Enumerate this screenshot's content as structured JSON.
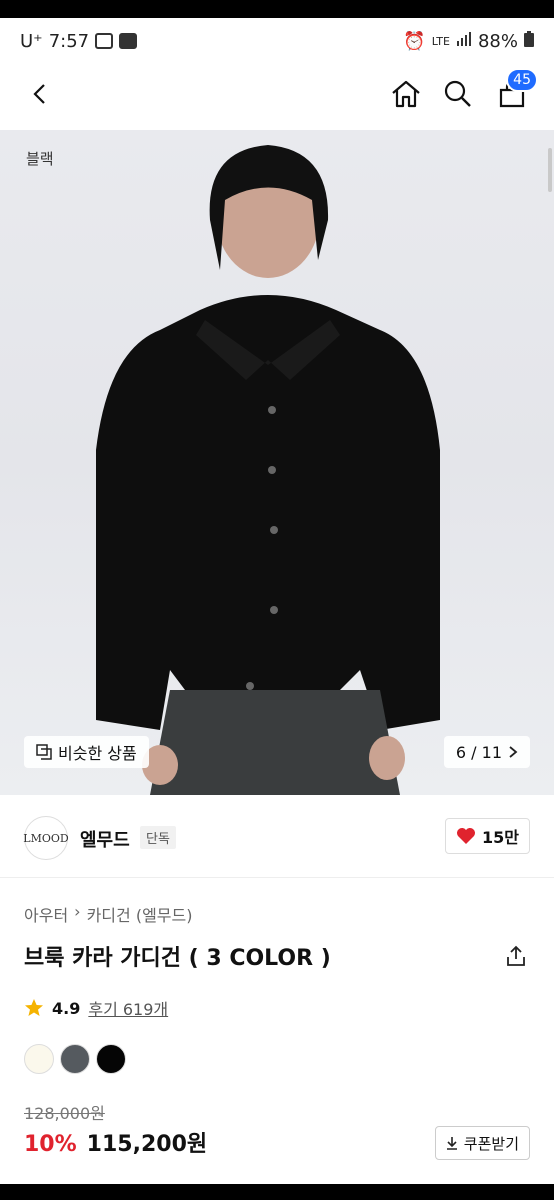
{
  "status_bar": {
    "carrier": "U⁺",
    "time": "7:57",
    "network": "LTE",
    "battery": "88%"
  },
  "header": {
    "cart_count": "45"
  },
  "hero": {
    "color_label": "블랙",
    "similar_label": "비슷한 상품",
    "pager": "6 / 11"
  },
  "brand": {
    "logo_text": "LMOOD",
    "name": "엘무드",
    "exclusive_label": "단독",
    "likes": "15만"
  },
  "breadcrumb": {
    "category": "아우터",
    "subcategory": "카디건 (엘무드)"
  },
  "product": {
    "title": "브룩 카라 가디건 ( 3 COLOR )",
    "rating": "4.9",
    "reviews": "후기 619개"
  },
  "swatches": [
    {
      "color": "#fbf8ec"
    },
    {
      "color": "#555a5f"
    },
    {
      "color": "#050505"
    }
  ],
  "pricing": {
    "original": "128,000원",
    "discount": "10%",
    "price": "115,200원",
    "coupon_label": "쿠폰받기"
  },
  "colors": {
    "accent_blue": "#1f6bff",
    "heart_red": "#e0232e",
    "discount_red": "#e0232e"
  }
}
